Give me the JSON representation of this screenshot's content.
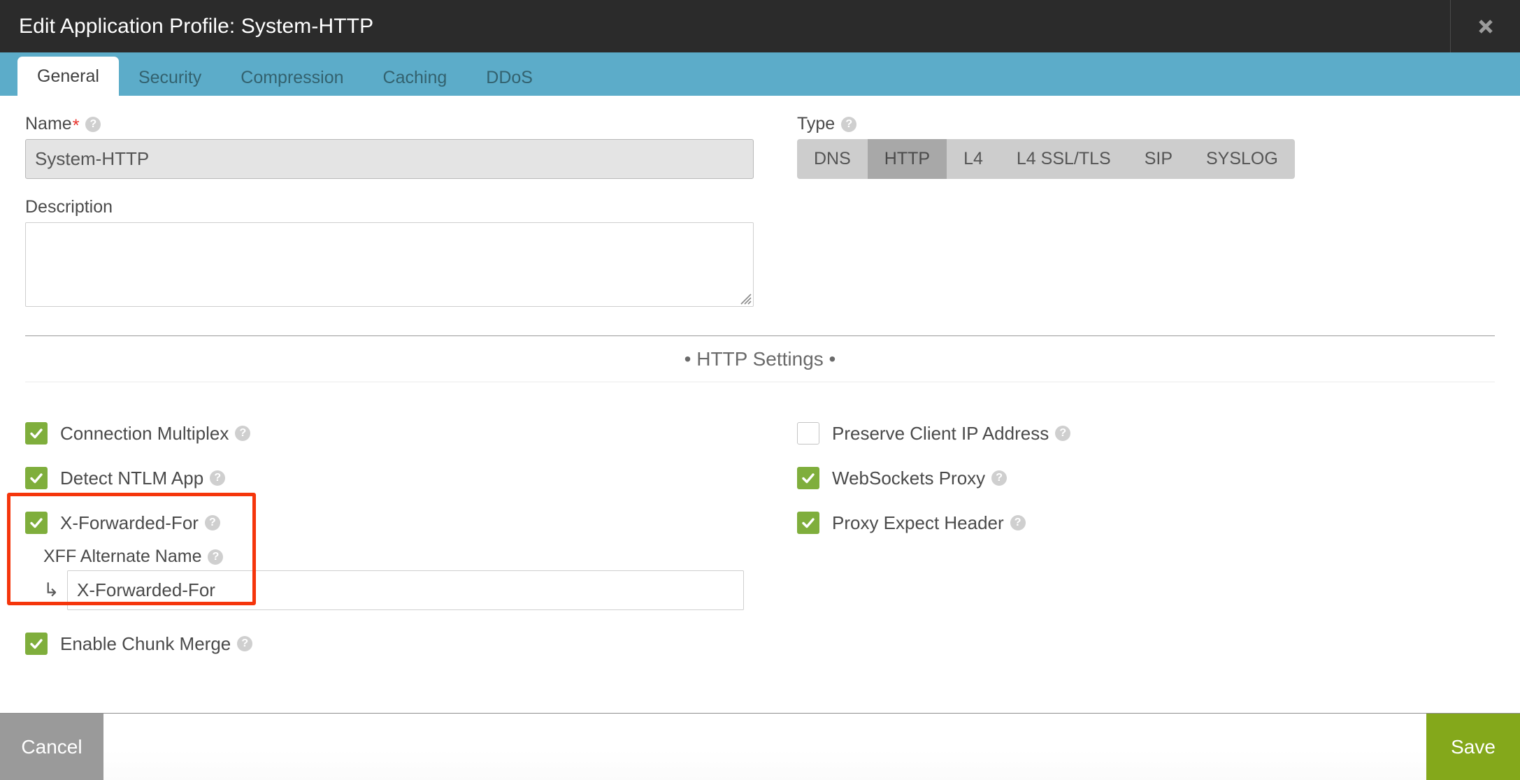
{
  "titlebar": {
    "title": "Edit Application Profile: System-HTTP",
    "close_icon": "close-x-icon"
  },
  "tabs": [
    {
      "label": "General",
      "active": true
    },
    {
      "label": "Security",
      "active": false
    },
    {
      "label": "Compression",
      "active": false
    },
    {
      "label": "Caching",
      "active": false
    },
    {
      "label": "DDoS",
      "active": false
    }
  ],
  "form": {
    "name": {
      "label": "Name",
      "required_marker": "*",
      "help_icon": "help-circle-icon",
      "value": "System-HTTP",
      "placeholder": "",
      "disabled": true
    },
    "description": {
      "label": "Description",
      "value": "",
      "placeholder": ""
    },
    "type": {
      "label": "Type",
      "help_icon": "help-circle-icon",
      "options": [
        "DNS",
        "HTTP",
        "L4",
        "L4 SSL/TLS",
        "SIP",
        "SYSLOG"
      ],
      "selected": "HTTP"
    }
  },
  "section": {
    "title": "• HTTP Settings •"
  },
  "settings": {
    "left": [
      {
        "label": "Connection Multiplex",
        "checked": true,
        "help_icon": "help-circle-icon"
      },
      {
        "label": "Detect NTLM App",
        "checked": true,
        "help_icon": "help-circle-icon"
      },
      {
        "label": "X-Forwarded-For",
        "checked": true,
        "help_icon": "help-circle-icon"
      },
      {
        "label": "Enable Chunk Merge",
        "checked": true,
        "help_icon": "help-circle-icon"
      }
    ],
    "right": [
      {
        "label": "Preserve Client IP Address",
        "checked": false,
        "help_icon": "help-circle-icon"
      },
      {
        "label": "WebSockets Proxy",
        "checked": true,
        "help_icon": "help-circle-icon"
      },
      {
        "label": "Proxy Expect Header",
        "checked": true,
        "help_icon": "help-circle-icon"
      }
    ],
    "xff_alternate_name": {
      "label": "XFF Alternate Name",
      "help_icon": "help-circle-icon",
      "arrow_icon": "sub-field-arrow-icon",
      "arrow_glyph": "↳",
      "value": "X-Forwarded-For",
      "placeholder": ""
    }
  },
  "footer": {
    "cancel_label": "Cancel",
    "save_label": "Save"
  },
  "colors": {
    "titlebar_bg": "#2b2b2b",
    "tabbar_bg": "#5cacc9",
    "checkbox_green": "#7fae3c",
    "save_green": "#84a81b",
    "cancel_gray": "#9a9a9a",
    "highlight_red": "#f5350b",
    "required_red": "#e8312a"
  }
}
